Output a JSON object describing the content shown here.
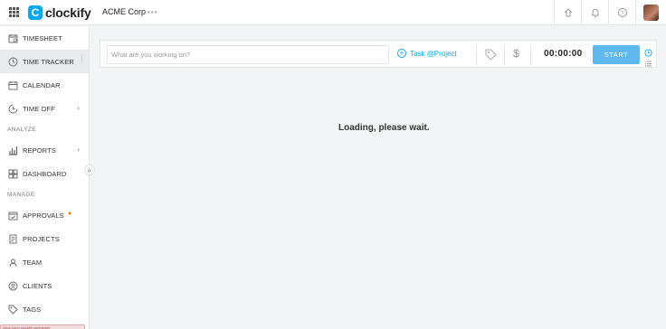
{
  "app": {
    "brand": "clockify",
    "brand_mark": "C",
    "workspace": "ACME Corp",
    "workspace_menu": "•••",
    "accent_color": "#03a9f4"
  },
  "topbar": {
    "icons": [
      "apps-grid-icon",
      "integrations-icon",
      "bell-icon",
      "help-icon",
      "user-avatar"
    ]
  },
  "sidebar": {
    "items": [
      {
        "label": "TIMESHEET",
        "icon": "timesheet-icon"
      },
      {
        "label": "TIME TRACKER",
        "icon": "clock-icon",
        "active": true
      },
      {
        "label": "CALENDAR",
        "icon": "calendar-icon"
      },
      {
        "label": "TIME OFF",
        "icon": "time-off-icon",
        "expandable": true
      }
    ],
    "analyze_label": "ANALYZE",
    "analyze_items": [
      {
        "label": "REPORTS",
        "icon": "reports-icon",
        "expandable": true
      },
      {
        "label": "DASHBOARD",
        "icon": "dashboard-icon"
      }
    ],
    "manage_label": "MANAGE",
    "manage_items": [
      {
        "label": "APPROVALS",
        "icon": "approvals-icon",
        "badge": "●"
      },
      {
        "label": "PROJECTS",
        "icon": "projects-icon"
      },
      {
        "label": "TEAM",
        "icon": "team-icon"
      },
      {
        "label": "CLIENTS",
        "icon": "clients-icon"
      },
      {
        "label": "TAGS",
        "icon": "tags-icon"
      }
    ],
    "collapse_glyph": "«",
    "status_url": "https://app.clockify.me/tracker"
  },
  "tracker": {
    "description_placeholder": "What are you working on?",
    "description_value": "",
    "project_label": "Task @Project",
    "billable_symbol": "$",
    "timer": "00:00:00",
    "start_label": "START"
  },
  "main": {
    "loading_text": "Loading, please wait."
  }
}
